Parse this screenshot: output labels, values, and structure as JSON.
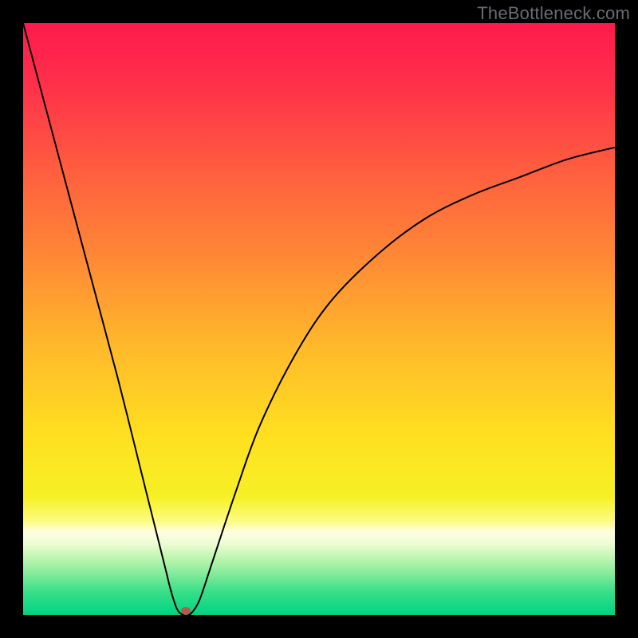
{
  "attribution": "TheBottleneck.com",
  "chart_data": {
    "type": "line",
    "title": "",
    "xlabel": "",
    "ylabel": "",
    "xlim": [
      0,
      100
    ],
    "ylim": [
      0,
      100
    ],
    "grid": false,
    "legend": false,
    "series": [
      {
        "name": "curve",
        "x": [
          0,
          4,
          8,
          12,
          16,
          20,
          22,
          24,
          25,
          26,
          27,
          28,
          29,
          30,
          32,
          36,
          40,
          46,
          52,
          60,
          68,
          76,
          84,
          92,
          100
        ],
        "values": [
          100,
          85,
          70,
          55,
          40,
          24,
          16,
          8,
          4,
          1,
          0,
          0,
          1,
          3,
          9,
          21,
          32,
          44,
          53,
          61,
          67,
          71,
          74,
          77,
          79
        ]
      }
    ],
    "marker": {
      "x": 27.5,
      "y": 0
    },
    "gradient_stops": [
      {
        "offset": 0.0,
        "color": "#ff1a4d"
      },
      {
        "offset": 0.1,
        "color": "#ff2f4a"
      },
      {
        "offset": 0.25,
        "color": "#ff5e3f"
      },
      {
        "offset": 0.4,
        "color": "#ff8a35"
      },
      {
        "offset": 0.55,
        "color": "#ffba2a"
      },
      {
        "offset": 0.7,
        "color": "#ffe020"
      },
      {
        "offset": 0.8,
        "color": "#f6f025"
      },
      {
        "offset": 0.84,
        "color": "#fdfb7d"
      },
      {
        "offset": 0.86,
        "color": "#fefee0"
      },
      {
        "offset": 0.88,
        "color": "#ecfdd4"
      },
      {
        "offset": 0.9,
        "color": "#c6f7b5"
      },
      {
        "offset": 0.93,
        "color": "#86eb9b"
      },
      {
        "offset": 0.96,
        "color": "#3adf89"
      },
      {
        "offset": 1.0,
        "color": "#00d483"
      }
    ],
    "marker_color": "#b35a4c"
  }
}
